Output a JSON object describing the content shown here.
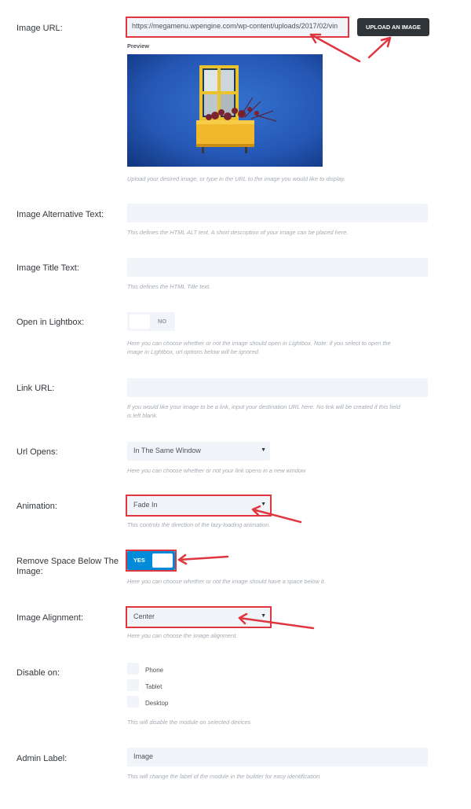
{
  "image_url": {
    "label": "Image URL:",
    "value": "https://megamenu.wpengine.com/wp-content/uploads/2017/02/vin",
    "upload_button": "UPLOAD AN IMAGE",
    "preview_label": "Preview",
    "description": "Upload your desired image, or type in the URL to the image you would like to display."
  },
  "alt_text": {
    "label": "Image Alternative Text:",
    "value": "",
    "description": "This defines the HTML ALT text. A short description of your image can be placed here."
  },
  "title_text": {
    "label": "Image Title Text:",
    "value": "",
    "description": "This defines the HTML Title text."
  },
  "lightbox": {
    "label": "Open in Lightbox:",
    "state": "NO",
    "description": "Here you can choose whether or not the image should open in Lightbox. Note: if you select to open the image in Lightbox, url options below will be ignored."
  },
  "link_url": {
    "label": "Link URL:",
    "value": "",
    "description": "If you would like your image to be a link, input your destination URL here. No link will be created if this field is left blank."
  },
  "url_opens": {
    "label": "Url Opens:",
    "selected": "In The Same Window",
    "description": "Here you can choose whether or not your link opens in a new window"
  },
  "animation": {
    "label": "Animation:",
    "selected": "Fade In",
    "description": "This controls the direction of the lazy-loading animation."
  },
  "remove_space": {
    "label_line1": "Remove Space Below The",
    "label_line2": "Image:",
    "state": "YES",
    "description": "Here you can choose whether or not the image should have a space below it."
  },
  "alignment": {
    "label": "Image Alignment:",
    "selected": "Center",
    "description": "Here you can choose the image alignment."
  },
  "disable_on": {
    "label": "Disable on:",
    "options": [
      "Phone",
      "Tablet",
      "Desktop"
    ],
    "description": "This will disable the module on selected devices"
  },
  "admin_label": {
    "label": "Admin Label:",
    "value": "Image",
    "description": "This will change the label of the module in the builder for easy identification."
  },
  "colors": {
    "accent": "#008bda",
    "annotation_red": "#e0363f",
    "field_bg": "#f1f5f9",
    "button_dark": "#2e3438"
  },
  "icons": {
    "dropdown": "caret-down-icon",
    "annotation": "red-arrow-icon"
  }
}
